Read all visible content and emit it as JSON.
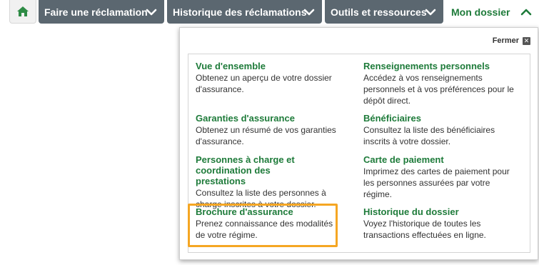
{
  "nav": {
    "home_icon": "home-icon",
    "tabs": [
      {
        "label": "Faire une réclamation"
      },
      {
        "label": "Historique des réclamations"
      },
      {
        "label": "Outils et ressources"
      },
      {
        "label": "Mon dossier"
      }
    ]
  },
  "panel": {
    "close_label": "Fermer",
    "items": [
      {
        "title": "Vue d'ensemble",
        "desc": "Obtenez un aperçu de votre dossier d'assurance."
      },
      {
        "title": "Renseignements personnels",
        "desc": "Accédez à vos renseignements personnels et à vos préférences pour le dépôt direct."
      },
      {
        "title": "Garanties d'assurance",
        "desc": "Obtenez un résumé de vos garanties d'assurance."
      },
      {
        "title": "Bénéficiaires",
        "desc": "Consultez la liste des bénéficiaires inscrits à votre dossier."
      },
      {
        "title": "Personnes à charge et coordination des prestations",
        "desc": "Consultez la liste des personnes à charge inscrites à votre dossier."
      },
      {
        "title": "Carte de paiement",
        "desc": "Imprimez des cartes de paiement pour les personnes assurées par votre régime."
      },
      {
        "title": "Brochure d'assurance",
        "desc": "Prenez connaissance des modalités de votre régime."
      },
      {
        "title": "Historique du dossier",
        "desc": "Voyez l'historique de toutes les transactions effectuées en ligne."
      }
    ]
  },
  "colors": {
    "accent": "#1e7b3a",
    "nav_bg": "#5b6770",
    "highlight": "#f5a623"
  }
}
